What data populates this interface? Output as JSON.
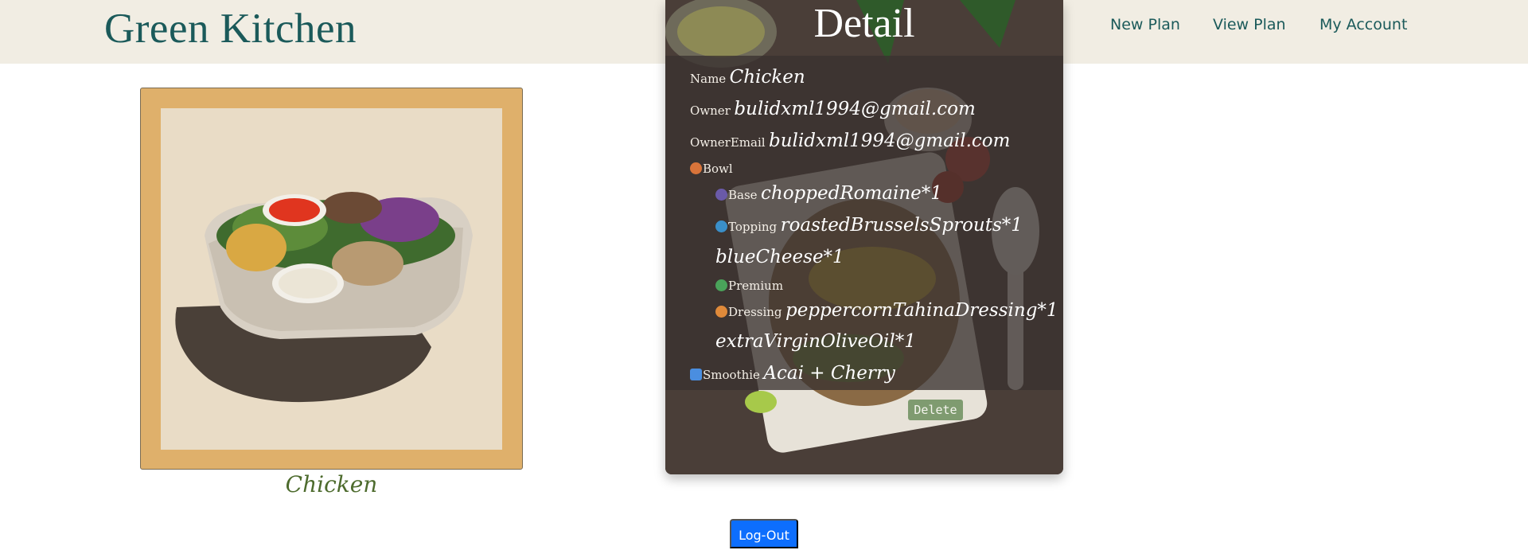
{
  "header": {
    "brand": "Green Kitchen",
    "nav": {
      "partial": "s",
      "new_plan": "New Plan",
      "view_plan": "View Plan",
      "my_account": "My Account"
    }
  },
  "card": {
    "caption": "Chicken"
  },
  "detail": {
    "title": "Detail",
    "name_label": "Name",
    "name_value": "Chicken",
    "owner_label": "Owner",
    "owner_value": "bulidxml1994@gmail.com",
    "owneremail_label": "OwnerEmail",
    "owneremail_value": "bulidxml1994@gmail.com",
    "bowl_label": "Bowl",
    "base_label": "Base",
    "base_value": "choppedRomaine*1",
    "topping_label": "Topping",
    "topping_value_1": "roastedBrusselsSprouts*1",
    "topping_value_2": "blueCheese*1",
    "premium_label": "Premium",
    "dressing_label": "Dressing",
    "dressing_value_1": "peppercornTahinaDressing*1",
    "dressing_value_2": "extraVirginOliveOil*1",
    "smoothie_label": "Smoothie",
    "smoothie_value": "Acai + Cherry",
    "delete_label": "Delete"
  },
  "footer": {
    "logout_label": "Log-Out"
  },
  "colors": {
    "header_bg": "#f1ede3",
    "brand": "#1b5a5a",
    "card_frame": "#dfb06b",
    "caption": "#4d6b2d",
    "delete_btn": "#7f9b70",
    "logout_btn": "#0d6efd"
  },
  "icons": {
    "bowl": "bowl-icon",
    "base": "leaf-icon",
    "topping": "topping-icon",
    "premium": "premium-icon",
    "dressing": "dressing-icon",
    "smoothie": "cup-icon"
  }
}
